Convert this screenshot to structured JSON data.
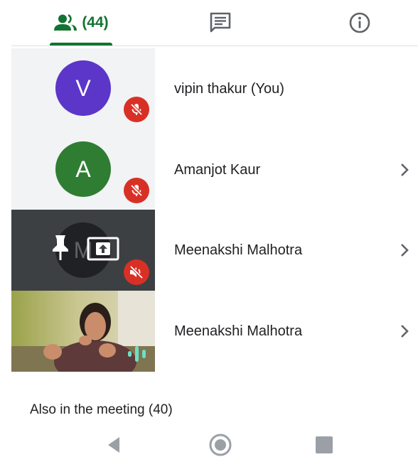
{
  "tabs": {
    "people_count": "(44)",
    "people_icon": "people-icon",
    "chat_icon": "chat-icon",
    "info_icon": "info-icon",
    "accent": "#137333"
  },
  "participants": [
    {
      "initial": "V",
      "name": "vipin thakur (You)",
      "avatar_color": "#5b36c8",
      "muted": true
    },
    {
      "initial": "A",
      "name": "Amanjot Kaur",
      "avatar_color": "#2e7d32",
      "muted": true
    },
    {
      "initial": "M",
      "name": "Meenakshi Malhotra",
      "presenting": true,
      "muted": true
    },
    {
      "name": "Meenakshi Malhotra",
      "video": true,
      "speaking": true
    }
  ],
  "also_in_meeting": "Also in the meeting (40)"
}
